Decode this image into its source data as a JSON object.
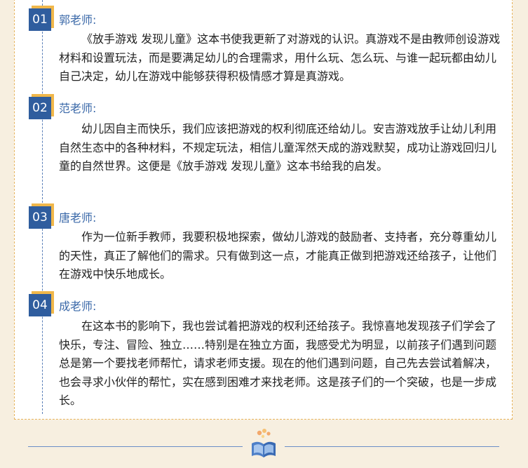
{
  "sections": [
    {
      "number": "01",
      "teacher": "郭老师:",
      "text": "《放手游戏 发现儿童》这本书使我更新了对游戏的认识。真游戏不是由教师创设游戏材料和设置玩法，而是要满足幼儿的合理需求，用什么玩、怎么玩、与谁一起玩都由幼儿自己决定，幼儿在游戏中能够获得积极情感才算是真游戏。"
    },
    {
      "number": "02",
      "teacher": "范老师:",
      "text": "幼儿因自主而快乐，我们应该把游戏的权利彻底还给幼儿。安吉游戏放手让幼儿利用自然生态中的各种材料，不规定玩法，相信儿童浑然天成的游戏默契，成功让游戏回归儿童的自然世界。这便是《放手游戏 发现儿童》这本书给我的启发。"
    },
    {
      "number": "03",
      "teacher": "唐老师:",
      "text": "作为一位新手教师，我要积极地探索，做幼儿游戏的鼓励者、支持者，充分尊重幼儿的天性，真正了解他们的需求。只有做到这一点，才能真正做到把游戏还给孩子，让他们在游戏中快乐地成长。"
    },
    {
      "number": "04",
      "teacher": "成老师:",
      "text": "在这本书的影响下，我也尝试着把游戏的权利还给孩子。我惊喜地发现孩子们学会了快乐，专注、冒险、独立……特别是在独立方面，我感受尤为明显，以前孩子们遇到问题总是第一个要找老师帮忙，请求老师支援。现在的他们遇到问题，自己先去尝试着解决，也会寻求小伙伴的帮忙，实在感到困难才来找老师。这是孩子们的一个突破，也是一步成长。"
    }
  ],
  "colors": {
    "badge": "#2f5d9e",
    "badge_accent": "#f0b74a",
    "teacher_name": "#3a68a8",
    "page_bg": "#f7efe0",
    "card_border": "#e6b25a"
  },
  "footer": {
    "icon": "open-book-icon"
  }
}
